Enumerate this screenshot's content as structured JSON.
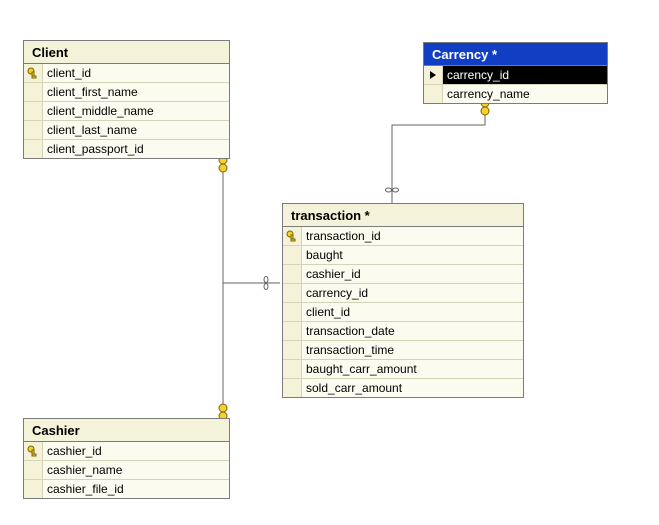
{
  "tables": {
    "client": {
      "title": "Client",
      "fields": [
        "client_id",
        "client_first_name",
        "client_middle_name",
        "client_last_name",
        "client_passport_id"
      ]
    },
    "carrency": {
      "title": "Carrency *",
      "fields": [
        "carrency_id",
        "carrency_name"
      ]
    },
    "transaction": {
      "title": "transaction *",
      "fields": [
        "transaction_id",
        "baught",
        "cashier_id",
        "carrency_id",
        "client_id",
        "transaction_date",
        "transaction_time",
        "baught_carr_amount",
        "sold_carr_amount"
      ]
    },
    "cashier": {
      "title": "Cashier",
      "fields": [
        "cashier_id",
        "cashier_name",
        "cashier_file_id"
      ]
    }
  },
  "relationships": [
    {
      "from": "client.client_id",
      "to": "transaction.client_id"
    },
    {
      "from": "carrency.carrency_id",
      "to": "transaction.carrency_id"
    },
    {
      "from": "cashier.cashier_id",
      "to": "transaction.cashier_id"
    }
  ],
  "chart_data": {
    "type": "table",
    "description": "Database schema diagram with 4 tables",
    "tables": [
      {
        "name": "Client",
        "pk": "client_id",
        "columns": [
          "client_id",
          "client_first_name",
          "client_middle_name",
          "client_last_name",
          "client_passport_id"
        ]
      },
      {
        "name": "Carrency",
        "pk": "carrency_id",
        "columns": [
          "carrency_id",
          "carrency_name"
        ],
        "selected": true
      },
      {
        "name": "transaction",
        "pk": "transaction_id",
        "columns": [
          "transaction_id",
          "baught",
          "cashier_id",
          "carrency_id",
          "client_id",
          "transaction_date",
          "transaction_time",
          "baught_carr_amount",
          "sold_carr_amount"
        ]
      },
      {
        "name": "Cashier",
        "pk": "cashier_id",
        "columns": [
          "cashier_id",
          "cashier_name",
          "cashier_file_id"
        ]
      }
    ],
    "foreign_keys": [
      {
        "table": "transaction",
        "column": "client_id",
        "references": "Client.client_id"
      },
      {
        "table": "transaction",
        "column": "carrency_id",
        "references": "Carrency.carrency_id"
      },
      {
        "table": "transaction",
        "column": "cashier_id",
        "references": "Cashier.cashier_id"
      }
    ]
  }
}
